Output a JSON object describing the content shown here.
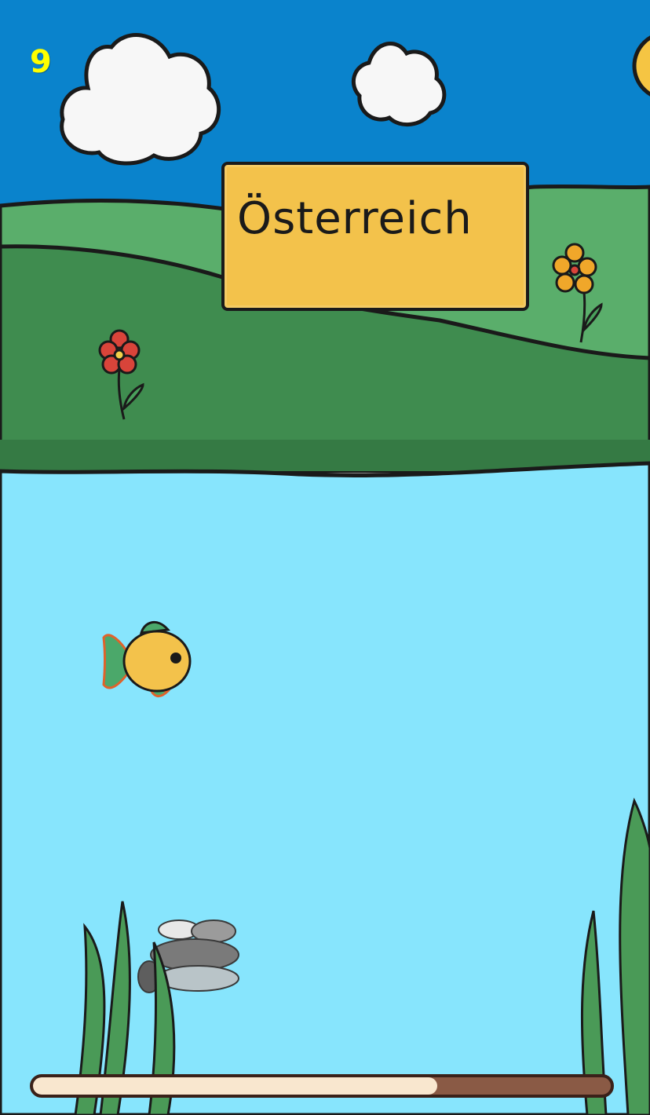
{
  "hud": {
    "score": "9",
    "progress": 0.7
  },
  "prompt_sign": {
    "word": "Österreich"
  },
  "colors": {
    "sky": "#0a83cc",
    "hill_light": "#55ab67",
    "hill_dark": "#3d8a4d",
    "water": "#87e5fd",
    "sign": "#f3c24b",
    "score": "#ffff00",
    "progress_track": "#8a5a45",
    "progress_fill": "#f9e7cf"
  },
  "icons": [
    "cloud-icon",
    "flower-icon",
    "fish-icon",
    "seaweed-icon",
    "rock-icon"
  ]
}
